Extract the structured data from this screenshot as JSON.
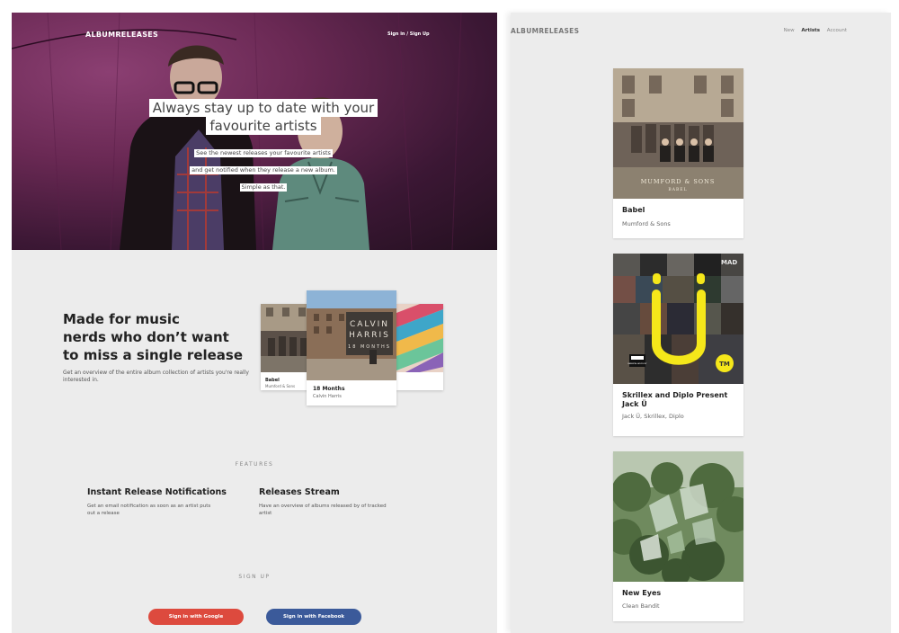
{
  "landing": {
    "brand": "ALBUMRELEASES",
    "signin_link": "Sign in / Sign Up",
    "headline_line1": "Always stay up to date with your",
    "headline_line2": "favourite artists",
    "sub_line1": "See the newest releases your favourite artists",
    "sub_line2": "and get notified when they release a new album.",
    "sub_line3": "Simple as that.",
    "pitch_line1": "Made for music",
    "pitch_line2": "nerds who don’t want",
    "pitch_line3": "to miss a single release",
    "pitch_desc": "Get an overview of the entire album collection of artists you're really interested in.",
    "preview_cards": [
      {
        "title": "Babel",
        "artist": "Mumford & Sons"
      },
      {
        "title": "18 Months",
        "artist": "Calvin Harris",
        "cover_text_1": "CALVIN",
        "cover_text_2": "HARRIS",
        "cover_text_3": "18 MONTHS"
      }
    ],
    "features_label": "FEATURES",
    "features": [
      {
        "title": "Instant Release Notifications",
        "desc": "Get an email notification as soon as an artist puts out a release"
      },
      {
        "title": "Releases Stream",
        "desc": "Have an overview of albums released by of tracked artist"
      }
    ],
    "signup_label": "SIGN UP",
    "google_button": "Sign in with Google",
    "facebook_button": "Sign in with Facebook"
  },
  "artists_page": {
    "brand": "ALBUMRELEASES",
    "nav": [
      "New",
      "Artists",
      "Account"
    ],
    "active_nav": "Artists",
    "albums": [
      {
        "title": "Babel",
        "artist": "Mumford & Sons",
        "cover_text_1": "MUMFORD & SONS",
        "cover_text_2": "BABEL"
      },
      {
        "title": "Skrillex and Diplo Present Jack Ü",
        "artist": "Jack Ü, Skrillex, Diplo",
        "cover_text_1": "MAD",
        "cover_text_2": "TM",
        "cover_text_3": "PARENTAL ADVISORY"
      },
      {
        "title": "New Eyes",
        "artist": "Clean Bandit"
      }
    ]
  },
  "colors": {
    "google": "#dd4a3e",
    "facebook": "#3b5a9a",
    "panel_bg": "#ececec",
    "hero_tint": "#6a2954"
  }
}
